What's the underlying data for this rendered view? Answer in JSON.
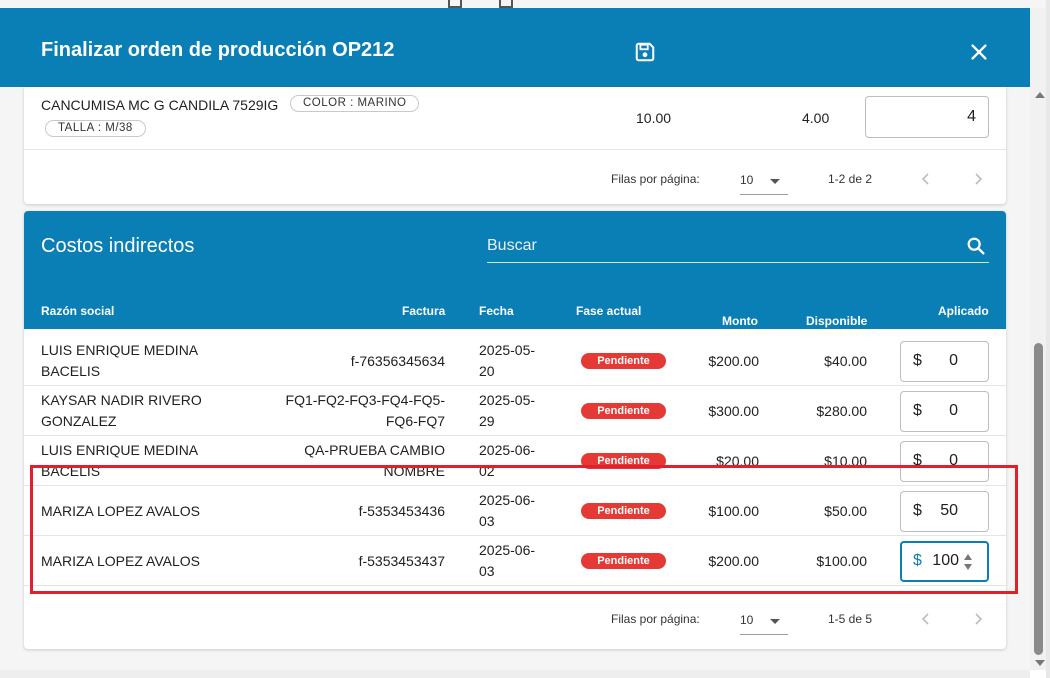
{
  "dialog": {
    "title": "Finalizar orden de producción OP212",
    "save_icon": "save-icon",
    "close_icon": "close-icon",
    "header_color": "#0a7fb5"
  },
  "product": {
    "name": "CANCUMISA MC G CANDILA 7529IG",
    "chips": [
      "COLOR : MARINO",
      "TALLA : M/38"
    ],
    "value_1": "10.00",
    "value_2": "4.00",
    "quantity": "4"
  },
  "product_pager": {
    "rows_label": "Filas por página:",
    "rows_value": "10",
    "range": "1-2 de 2"
  },
  "costs": {
    "title": "Costos indirectos",
    "search_placeholder": "Buscar",
    "columns": [
      "Razón social",
      "Factura",
      "Fecha",
      "Fase actual",
      "Monto",
      "Disponible",
      "Aplicado"
    ],
    "currency": "$",
    "rows": [
      {
        "razon": "LUIS ENRIQUE MEDINA BACELIS",
        "factura": "f-76356345634",
        "fecha": "2025-05-20",
        "fase": "Pendiente",
        "monto": "$200.00",
        "disponible": "$40.00",
        "aplicado": "0"
      },
      {
        "razon": "KAYSAR NADIR RIVERO GONZALEZ",
        "factura": "FQ1-FQ2-FQ3-FQ4-FQ5-FQ6-FQ7",
        "fecha": "2025-05-29",
        "fase": "Pendiente",
        "monto": "$300.00",
        "disponible": "$280.00",
        "aplicado": "0"
      },
      {
        "razon": "LUIS ENRIQUE MEDINA BACELIS",
        "factura": "QA-PRUEBA CAMBIO NOMBRE",
        "fecha": "2025-06-02",
        "fase": "Pendiente",
        "monto": "$20.00",
        "disponible": "$10.00",
        "aplicado": "0"
      },
      {
        "razon": "MARIZA LOPEZ AVALOS",
        "factura": "f-5353453436",
        "fecha": "2025-06-03",
        "fase": "Pendiente",
        "monto": "$100.00",
        "disponible": "$50.00",
        "aplicado": "50"
      },
      {
        "razon": "MARIZA LOPEZ AVALOS",
        "factura": "f-5353453437",
        "fecha": "2025-06-03",
        "fase": "Pendiente",
        "monto": "$200.00",
        "disponible": "$100.00",
        "aplicado": "100"
      }
    ]
  },
  "costs_pager": {
    "rows_label": "Filas por página:",
    "rows_value": "10",
    "range": "1-5 de 5"
  },
  "colors": {
    "primary": "#0a7fb5",
    "badge": "#e53935",
    "highlight": "#e0202a"
  }
}
